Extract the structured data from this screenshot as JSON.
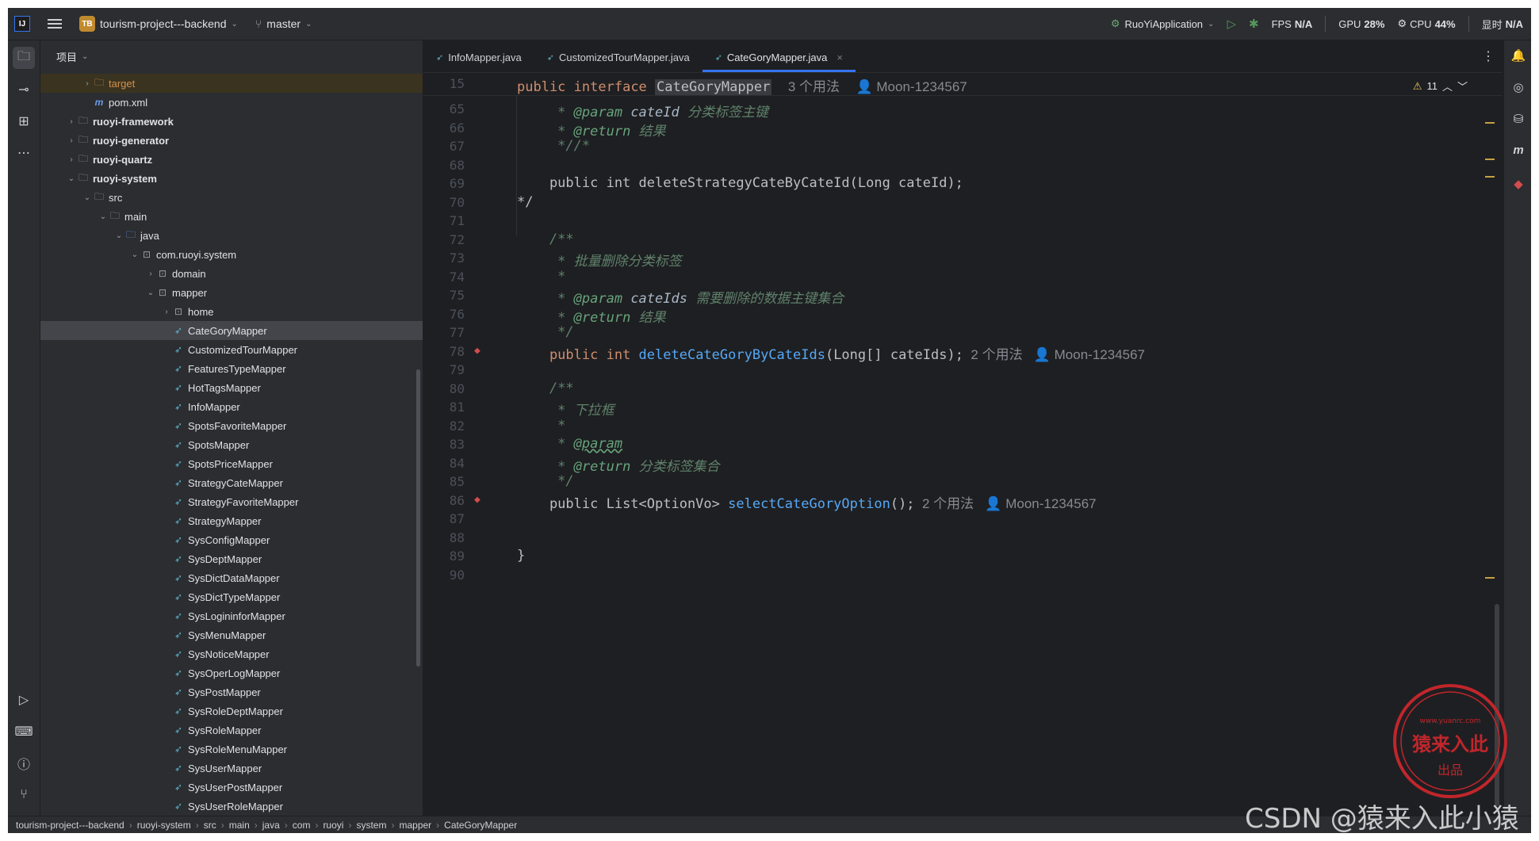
{
  "titlebar": {
    "project_badge": "TB",
    "project_name": "tourism-project---backend",
    "branch": "master",
    "run_config": "RuoYiApplication",
    "fps_label": "FPS",
    "fps_value": "N/A",
    "gpu_label": "GPU",
    "gpu_value": "28%",
    "cpu_label": "CPU",
    "cpu_value": "44%",
    "mem_label": "显时",
    "mem_value": "N/A"
  },
  "project_panel": {
    "title": "项目",
    "rows": [
      {
        "label": "target",
        "kind": "folder",
        "depth": 2,
        "arrow": "›",
        "style": "orange",
        "highlight": true
      },
      {
        "label": "pom.xml",
        "kind": "maven",
        "depth": 2,
        "arrow": ""
      },
      {
        "label": "ruoyi-framework",
        "kind": "module",
        "depth": 1,
        "arrow": "›",
        "style": "bold"
      },
      {
        "label": "ruoyi-generator",
        "kind": "module",
        "depth": 1,
        "arrow": "›",
        "style": "bold"
      },
      {
        "label": "ruoyi-quartz",
        "kind": "module",
        "depth": 1,
        "arrow": "›",
        "style": "bold"
      },
      {
        "label": "ruoyi-system",
        "kind": "module",
        "depth": 1,
        "arrow": "⌄",
        "style": "bold"
      },
      {
        "label": "src",
        "kind": "folder",
        "depth": 2,
        "arrow": "⌄"
      },
      {
        "label": "main",
        "kind": "folder",
        "depth": 3,
        "arrow": "⌄"
      },
      {
        "label": "java",
        "kind": "folder-blue",
        "depth": 4,
        "arrow": "⌄"
      },
      {
        "label": "com.ruoyi.system",
        "kind": "package",
        "depth": 5,
        "arrow": "⌄"
      },
      {
        "label": "domain",
        "kind": "package",
        "depth": 6,
        "arrow": "›"
      },
      {
        "label": "mapper",
        "kind": "package",
        "depth": 6,
        "arrow": "⌄"
      },
      {
        "label": "home",
        "kind": "package",
        "depth": 7,
        "arrow": "›"
      },
      {
        "label": "CateGoryMapper",
        "kind": "mapper",
        "depth": 7,
        "arrow": "",
        "selected": true
      },
      {
        "label": "CustomizedTourMapper",
        "kind": "mapper",
        "depth": 7,
        "arrow": ""
      },
      {
        "label": "FeaturesTypeMapper",
        "kind": "mapper",
        "depth": 7,
        "arrow": ""
      },
      {
        "label": "HotTagsMapper",
        "kind": "mapper",
        "depth": 7,
        "arrow": ""
      },
      {
        "label": "InfoMapper",
        "kind": "mapper",
        "depth": 7,
        "arrow": ""
      },
      {
        "label": "SpotsFavoriteMapper",
        "kind": "mapper",
        "depth": 7,
        "arrow": ""
      },
      {
        "label": "SpotsMapper",
        "kind": "mapper",
        "depth": 7,
        "arrow": ""
      },
      {
        "label": "SpotsPriceMapper",
        "kind": "mapper",
        "depth": 7,
        "arrow": ""
      },
      {
        "label": "StrategyCateMapper",
        "kind": "mapper",
        "depth": 7,
        "arrow": ""
      },
      {
        "label": "StrategyFavoriteMapper",
        "kind": "mapper",
        "depth": 7,
        "arrow": ""
      },
      {
        "label": "StrategyMapper",
        "kind": "mapper",
        "depth": 7,
        "arrow": ""
      },
      {
        "label": "SysConfigMapper",
        "kind": "mapper",
        "depth": 7,
        "arrow": ""
      },
      {
        "label": "SysDeptMapper",
        "kind": "mapper",
        "depth": 7,
        "arrow": ""
      },
      {
        "label": "SysDictDataMapper",
        "kind": "mapper",
        "depth": 7,
        "arrow": ""
      },
      {
        "label": "SysDictTypeMapper",
        "kind": "mapper",
        "depth": 7,
        "arrow": ""
      },
      {
        "label": "SysLogininforMapper",
        "kind": "mapper",
        "depth": 7,
        "arrow": ""
      },
      {
        "label": "SysMenuMapper",
        "kind": "mapper",
        "depth": 7,
        "arrow": ""
      },
      {
        "label": "SysNoticeMapper",
        "kind": "mapper",
        "depth": 7,
        "arrow": ""
      },
      {
        "label": "SysOperLogMapper",
        "kind": "mapper",
        "depth": 7,
        "arrow": ""
      },
      {
        "label": "SysPostMapper",
        "kind": "mapper",
        "depth": 7,
        "arrow": ""
      },
      {
        "label": "SysRoleDeptMapper",
        "kind": "mapper",
        "depth": 7,
        "arrow": ""
      },
      {
        "label": "SysRoleMapper",
        "kind": "mapper",
        "depth": 7,
        "arrow": ""
      },
      {
        "label": "SysRoleMenuMapper",
        "kind": "mapper",
        "depth": 7,
        "arrow": ""
      },
      {
        "label": "SysUserMapper",
        "kind": "mapper",
        "depth": 7,
        "arrow": ""
      },
      {
        "label": "SysUserPostMapper",
        "kind": "mapper",
        "depth": 7,
        "arrow": ""
      },
      {
        "label": "SysUserRoleMapper",
        "kind": "mapper",
        "depth": 7,
        "arrow": ""
      }
    ]
  },
  "editor": {
    "tabs": [
      {
        "label": "InfoMapper.java",
        "active": false
      },
      {
        "label": "CustomizedTourMapper.java",
        "active": false
      },
      {
        "label": "CateGoryMapper.java",
        "active": true
      }
    ],
    "warnings_count": "11",
    "sticky": {
      "line_no": "15",
      "public_kw": "public",
      "interface_kw": "interface",
      "name": "CateGoryMapper",
      "usages": "3 个用法",
      "author": "Moon-1234567"
    },
    "lines": [
      {
        "no": "65",
        "parts": [
          {
            "t": "     * ",
            "c": "doc"
          },
          {
            "t": "@param",
            "c": "tag"
          },
          {
            "t": " cateId",
            "c": "param"
          },
          {
            "t": " 分类标签主键",
            "c": "doc"
          }
        ]
      },
      {
        "no": "66",
        "parts": [
          {
            "t": "     * ",
            "c": "doc"
          },
          {
            "t": "@return",
            "c": "tag"
          },
          {
            "t": " 结果",
            "c": "doc"
          }
        ]
      },
      {
        "no": "67",
        "parts": [
          {
            "t": "     *//*",
            "c": "doc"
          }
        ]
      },
      {
        "no": "68",
        "parts": []
      },
      {
        "no": "69",
        "parts": [
          {
            "t": "    public int deleteStrategyCateByCateId(Long cateId);",
            "c": "plain"
          }
        ]
      },
      {
        "no": "70",
        "parts": [
          {
            "t": "*/",
            "c": "plain"
          }
        ]
      },
      {
        "no": "71",
        "parts": []
      },
      {
        "no": "72",
        "parts": [
          {
            "t": "    /**",
            "c": "doc"
          }
        ]
      },
      {
        "no": "73",
        "parts": [
          {
            "t": "     * 批量删除分类标签",
            "c": "doc"
          }
        ]
      },
      {
        "no": "74",
        "parts": [
          {
            "t": "     *",
            "c": "doc"
          }
        ]
      },
      {
        "no": "75",
        "parts": [
          {
            "t": "     * ",
            "c": "doc"
          },
          {
            "t": "@param",
            "c": "tag"
          },
          {
            "t": " cateIds",
            "c": "param"
          },
          {
            "t": " 需要删除的数据主键集合",
            "c": "doc"
          }
        ]
      },
      {
        "no": "76",
        "parts": [
          {
            "t": "     * ",
            "c": "doc"
          },
          {
            "t": "@return",
            "c": "tag"
          },
          {
            "t": " 结果",
            "c": "doc"
          }
        ]
      },
      {
        "no": "77",
        "parts": [
          {
            "t": "     */",
            "c": "doc"
          }
        ]
      },
      {
        "no": "78",
        "impl": true,
        "parts": [
          {
            "t": "    public ",
            "c": "kw"
          },
          {
            "t": "int ",
            "c": "kw"
          },
          {
            "t": "deleteCateGoryByCateIds",
            "c": "fn"
          },
          {
            "t": "(Long[] cateIds);",
            "c": "plain"
          },
          {
            "t": "  2 个用法   ",
            "c": "hint"
          },
          {
            "t": "👤 Moon-1234567",
            "c": "hint"
          }
        ]
      },
      {
        "no": "79",
        "parts": []
      },
      {
        "no": "80",
        "parts": [
          {
            "t": "    /**",
            "c": "doc"
          }
        ]
      },
      {
        "no": "81",
        "parts": [
          {
            "t": "     * 下拉框",
            "c": "doc"
          }
        ]
      },
      {
        "no": "82",
        "parts": [
          {
            "t": "     *",
            "c": "doc"
          }
        ]
      },
      {
        "no": "83",
        "parts": [
          {
            "t": "     * ",
            "c": "doc"
          },
          {
            "t": "@param",
            "c": "tag under"
          }
        ]
      },
      {
        "no": "84",
        "parts": [
          {
            "t": "     * ",
            "c": "doc"
          },
          {
            "t": "@return",
            "c": "tag"
          },
          {
            "t": " 分类标签集合",
            "c": "doc"
          }
        ]
      },
      {
        "no": "85",
        "parts": [
          {
            "t": "     */",
            "c": "doc"
          }
        ]
      },
      {
        "no": "86",
        "impl": true,
        "parts": [
          {
            "t": "    public ",
            "c": "plain"
          },
          {
            "t": "List<OptionVo> ",
            "c": "plain"
          },
          {
            "t": "selectCateGoryOption",
            "c": "fn"
          },
          {
            "t": "();",
            "c": "plain"
          },
          {
            "t": "  2 个用法   ",
            "c": "hint"
          },
          {
            "t": "👤 Moon-1234567",
            "c": "hint"
          }
        ]
      },
      {
        "no": "87",
        "parts": []
      },
      {
        "no": "88",
        "parts": []
      },
      {
        "no": "89",
        "parts": [
          {
            "t": "}",
            "c": "plain"
          }
        ]
      },
      {
        "no": "90",
        "parts": []
      }
    ]
  },
  "statusbar": {
    "crumbs": [
      "tourism-project---backend",
      "ruoyi-system",
      "src",
      "main",
      "java",
      "com",
      "ruoyi",
      "system",
      "mapper",
      "CateGoryMapper"
    ]
  },
  "watermark": {
    "text": "CSDN @猿来入此小猿",
    "stamp_top": "www.yuanrc.com",
    "stamp_mid": "猿来入此",
    "stamp_bottom": "出品"
  }
}
